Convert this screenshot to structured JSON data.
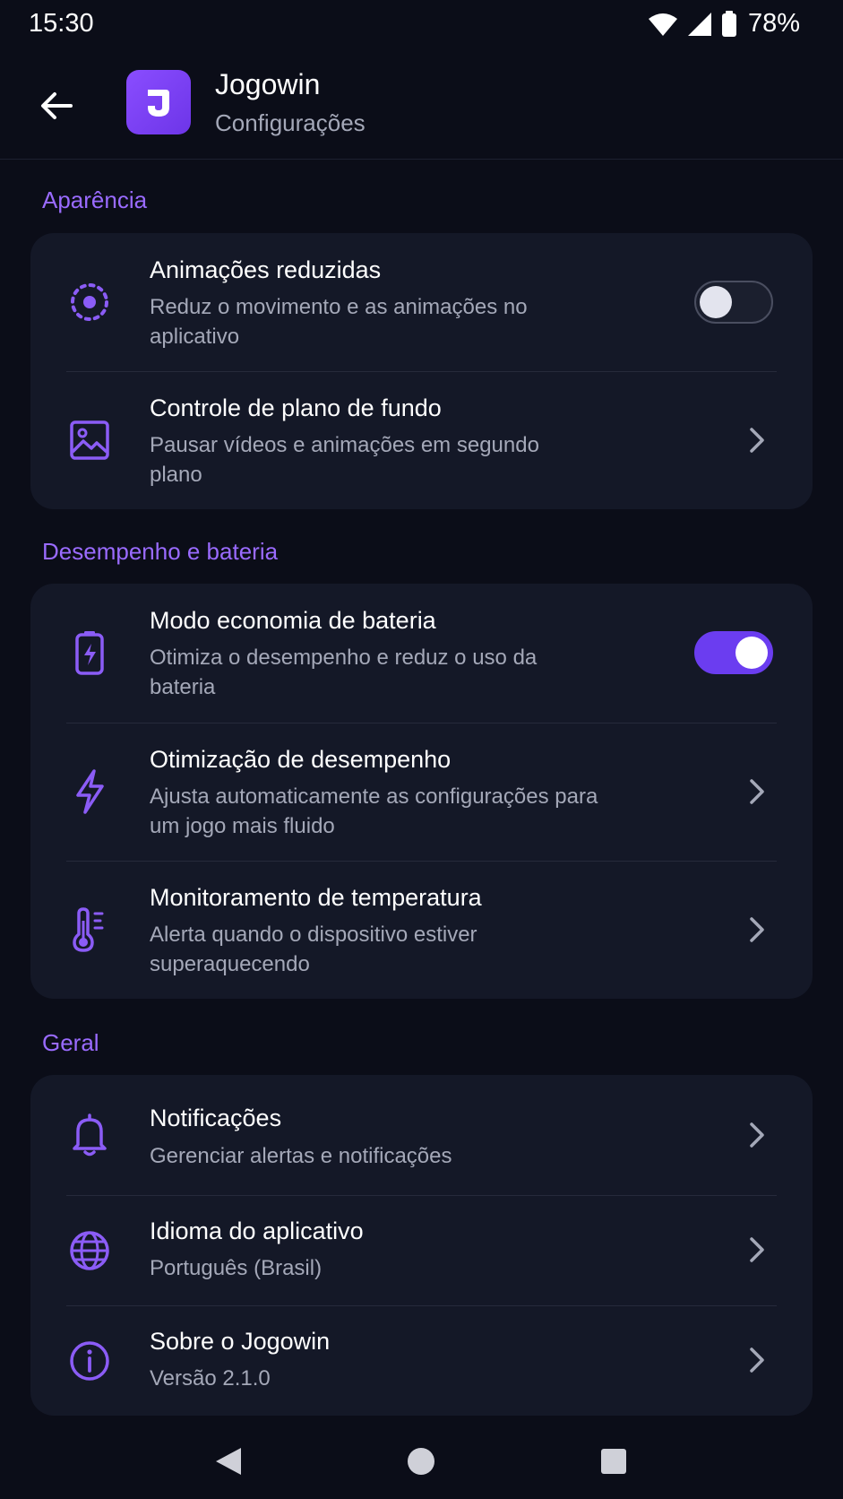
{
  "status_bar": {
    "time": "15:30",
    "battery": "78%"
  },
  "app_bar": {
    "title": "Jogowin",
    "subtitle": "Configurações"
  },
  "sections": [
    {
      "title": "Aparência",
      "rows": [
        {
          "icon": "reduced-motion-icon",
          "title": "Animações reduzidas",
          "desc": "Reduz o movimento e as animações no aplicativo",
          "control": "toggle",
          "toggle_on": false
        },
        {
          "icon": "image-icon",
          "title": "Controle de plano de fundo",
          "desc": "Pausar vídeos e animações em segundo plano",
          "control": "chevron"
        }
      ]
    },
    {
      "title": "Desempenho e bateria",
      "rows": [
        {
          "icon": "battery-saver-icon",
          "title": "Modo economia de bateria",
          "desc": "Otimiza o desempenho e reduz o uso da bateria",
          "control": "toggle",
          "toggle_on": true
        },
        {
          "icon": "lightning-icon",
          "title": "Otimização de desempenho",
          "desc": "Ajusta automaticamente as configurações para um jogo mais fluido",
          "control": "chevron"
        },
        {
          "icon": "thermometer-icon",
          "title": "Monitoramento de temperatura",
          "desc": "Alerta quando o dispositivo estiver superaquecendo",
          "control": "chevron"
        }
      ]
    },
    {
      "title": "Geral",
      "rows": [
        {
          "icon": "bell-icon",
          "title": "Notificações",
          "desc": "Gerenciar alertas e notificações",
          "control": "chevron"
        },
        {
          "icon": "globe-icon",
          "title": "Idioma do aplicativo",
          "desc": "Português (Brasil)",
          "control": "chevron"
        },
        {
          "icon": "info-icon",
          "title": "Sobre o Jogowin",
          "desc": "Versão 2.1.0",
          "control": "chevron"
        }
      ]
    }
  ],
  "colors": {
    "accent": "#7c4dff",
    "section_title": "#9a6bff",
    "background": "#0b0d18",
    "card": "#141827"
  }
}
